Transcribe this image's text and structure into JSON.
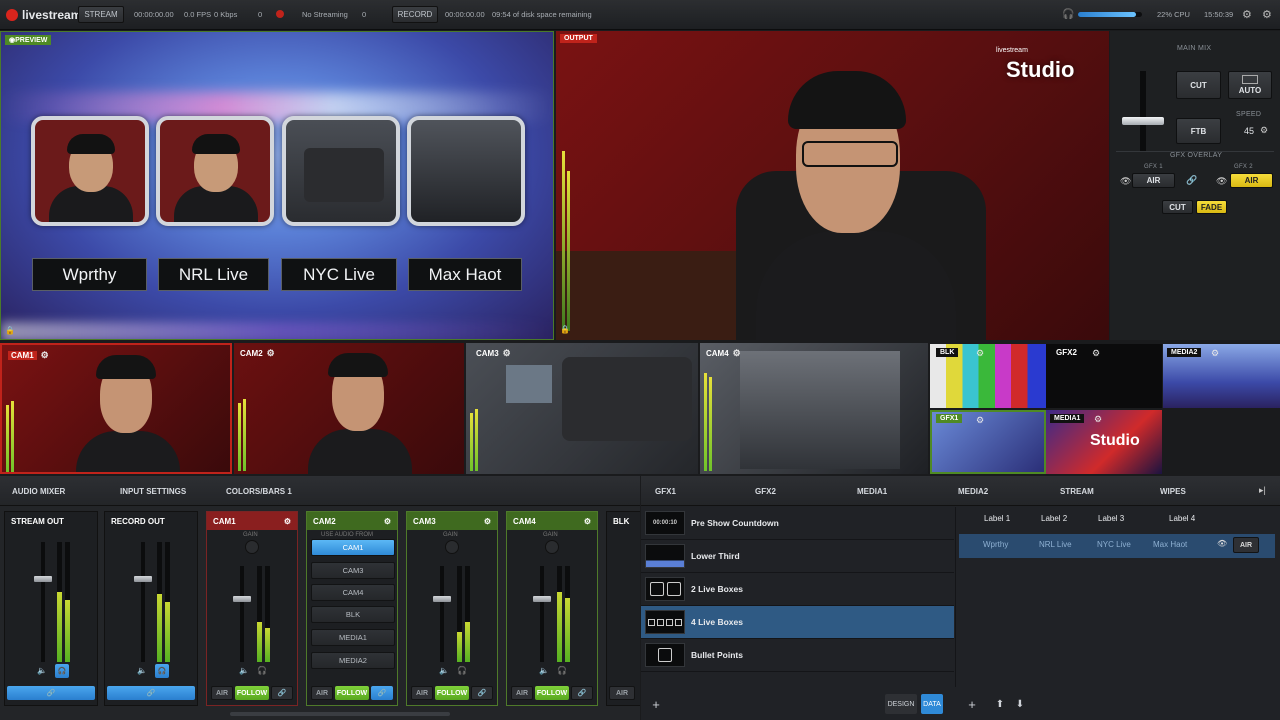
{
  "topbar": {
    "app_name": "livestream",
    "stream_label": "STREAM",
    "stream_time": "00:00:00.00",
    "fps": "0.0 FPS",
    "kbps": "0 Kbps",
    "counter": "0",
    "no_streaming": "No Streaming",
    "stream_count": "0",
    "record_label": "RECORD",
    "record_time": "00:00:00.00",
    "disk_space": "09:54 of disk space remaining",
    "cpu": "22% CPU",
    "clock": "15:50:39"
  },
  "preview": {
    "tag": "PREVIEW",
    "labels": [
      "Wprthy",
      "NRL Live",
      "NYC Live",
      "Max Haot"
    ]
  },
  "output": {
    "tag": "OUTPUT",
    "brand_small": "livestream",
    "brand_big": "Studio"
  },
  "main_mix": {
    "title": "MAIN MIX",
    "cut": "CUT",
    "auto": "AUTO",
    "ftb": "FTB",
    "speed_label": "SPEED",
    "speed_value": "45",
    "gfx_overlay_title": "GFX OVERLAY",
    "gfx1_label": "GFX 1",
    "gfx2_label": "GFX 2",
    "air1": "AIR",
    "air2": "AIR",
    "overlay_cut": "CUT",
    "overlay_fade": "FADE"
  },
  "sources": {
    "cam1": "CAM1",
    "cam2": "CAM2",
    "cam3": "CAM3",
    "cam4": "CAM4",
    "blk": "BLK",
    "gfx2": "GFX2",
    "media2": "MEDIA2",
    "gfx1": "GFX1",
    "media1": "MEDIA1",
    "media1_brand": "Studio"
  },
  "audio_tabs": [
    "AUDIO MIXER",
    "INPUT SETTINGS",
    "COLORS/BARS 1"
  ],
  "strips": {
    "stream_out": "STREAM OUT",
    "record_out": "RECORD OUT",
    "cam1": "CAM1",
    "cam2": "CAM2",
    "cam3": "CAM3",
    "cam4": "CAM4",
    "blk": "BLK",
    "gain": "GAIN",
    "use_audio_from": "USE AUDIO FROM",
    "audio_sources": [
      "CAM1",
      "CAM3",
      "CAM4",
      "BLK",
      "MEDIA1",
      "MEDIA2"
    ],
    "air": "AIR",
    "follow": "FOLLOW"
  },
  "gfx_tabs": [
    "GFX1",
    "GFX2",
    "MEDIA1",
    "MEDIA2",
    "STREAM",
    "WIPES"
  ],
  "gfx_items": [
    "Pre Show Countdown",
    "Lower Third",
    "2 Live Boxes",
    "4 Live Boxes",
    "Bullet Points"
  ],
  "gfx_countdown_thumb": "00:00:10",
  "gfx_columns": [
    "Label 1",
    "Label 2",
    "Label 3",
    "Label 4"
  ],
  "gfx_row": [
    "Wprthy",
    "NRL Live",
    "NYC Live",
    "Max Haot"
  ],
  "gfx_row_air": "AIR",
  "gfx_bottom": {
    "design": "DESIGN",
    "data": "DATA"
  }
}
